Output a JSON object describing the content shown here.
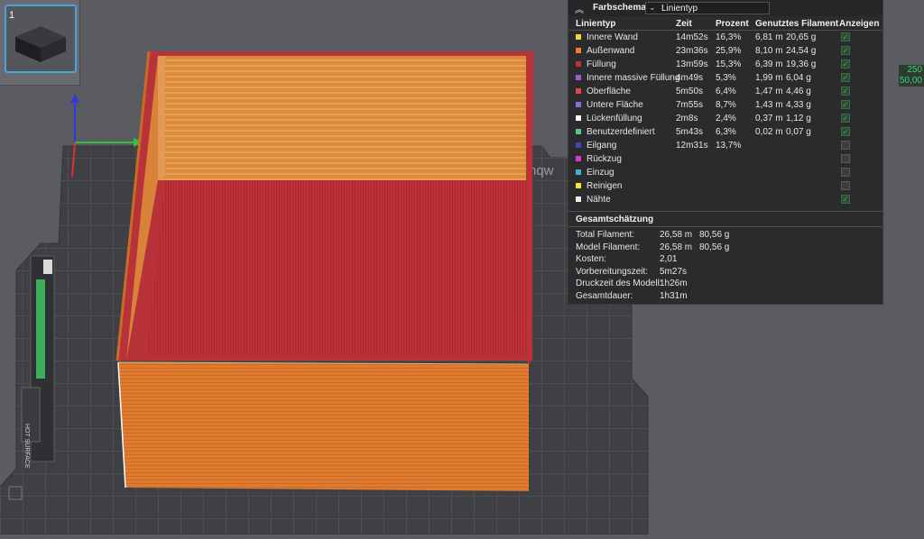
{
  "thumbnail": {
    "number": "1"
  },
  "ruler": {
    "top_value": "250",
    "bottom_value": "50,00"
  },
  "bed": {
    "logo_text": "nqw",
    "hot_surface_text": "HOT SURFACE"
  },
  "panel": {
    "title": "Farbschema",
    "dropdown_value": "Linientyp",
    "columns": [
      "Linientyp",
      "Zeit",
      "Prozent",
      "Genutztes Filament",
      "Anzeigen"
    ],
    "rows": [
      {
        "name": "Innere Wand",
        "time": "14m52s",
        "percent": "16,3%",
        "meters": "6,81 m",
        "grams": "20,65 g",
        "color": "#f3d33e",
        "shown": true
      },
      {
        "name": "Außenwand",
        "time": "23m36s",
        "percent": "25,9%",
        "meters": "8,10 m",
        "grams": "24,54 g",
        "color": "#f07b2e",
        "shown": true
      },
      {
        "name": "Füllung",
        "time": "13m59s",
        "percent": "15,3%",
        "meters": "6,39 m",
        "grams": "19,36 g",
        "color": "#b8323a",
        "shown": true
      },
      {
        "name": "Innere massive Füllung",
        "time": "4m49s",
        "percent": "5,3%",
        "meters": "1,99 m",
        "grams": "6,04 g",
        "color": "#a05ad6",
        "shown": true
      },
      {
        "name": "Oberfläche",
        "time": "5m50s",
        "percent": "6,4%",
        "meters": "1,47 m",
        "grams": "4,46 g",
        "color": "#e5444a",
        "shown": true
      },
      {
        "name": "Untere Fläche",
        "time": "7m55s",
        "percent": "8,7%",
        "meters": "1,43 m",
        "grams": "4,33 g",
        "color": "#7c6fe0",
        "shown": true
      },
      {
        "name": "Lückenfüllung",
        "time": "2m8s",
        "percent": "2,4%",
        "meters": "0,37 m",
        "grams": "1,12 g",
        "color": "#ffffff",
        "shown": true
      },
      {
        "name": "Benutzerdefiniert",
        "time": "5m43s",
        "percent": "6,3%",
        "meters": "0,02 m",
        "grams": "0,07 g",
        "color": "#4ec98a",
        "shown": true
      },
      {
        "name": "Eilgang",
        "time": "12m31s",
        "percent": "13,7%",
        "meters": "",
        "grams": "",
        "color": "#3a4bb5",
        "shown": false
      },
      {
        "name": "Rückzug",
        "time": "",
        "percent": "",
        "meters": "",
        "grams": "",
        "color": "#d83ad0",
        "shown": false
      },
      {
        "name": "Einzug",
        "time": "",
        "percent": "",
        "meters": "",
        "grams": "",
        "color": "#3ab3d8",
        "shown": false
      },
      {
        "name": "Reinigen",
        "time": "",
        "percent": "",
        "meters": "",
        "grams": "",
        "color": "#f2e63a",
        "shown": false
      },
      {
        "name": "Nähte",
        "time": "",
        "percent": "",
        "meters": "",
        "grams": "",
        "color": "#f0f0f0",
        "shown": true
      }
    ],
    "estimate_title": "Gesamtschätzung",
    "estimates": [
      {
        "label": "Total Filament:",
        "v1": "26,58 m",
        "v2": "80,56 g"
      },
      {
        "label": "Model Filament:",
        "v1": "26,58 m",
        "v2": "80,56 g"
      },
      {
        "label": "Kosten:",
        "v1": "2,01",
        "v2": ""
      },
      {
        "label": "Vorbereitungszeit:",
        "v1": "5m27s",
        "v2": ""
      },
      {
        "label": "Druckzeit des Modell:",
        "v1": "1h26m",
        "v2": ""
      },
      {
        "label": "Gesamtdauer:",
        "v1": "1h31m",
        "v2": ""
      }
    ]
  }
}
